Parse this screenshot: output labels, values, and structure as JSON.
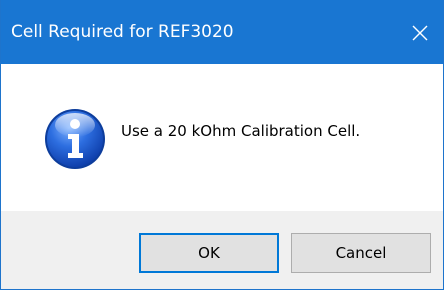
{
  "window": {
    "title": "Cell Required for REF3020",
    "close_icon": "close-icon"
  },
  "message": {
    "icon": "info-icon",
    "text": "Use a 20 kOhm Calibration Cell."
  },
  "buttons": {
    "ok_label": "OK",
    "cancel_label": "Cancel"
  },
  "colors": {
    "titlebar": "#1976d2",
    "button_bar": "#f0f0f0",
    "default_button_border": "#0078d7"
  }
}
